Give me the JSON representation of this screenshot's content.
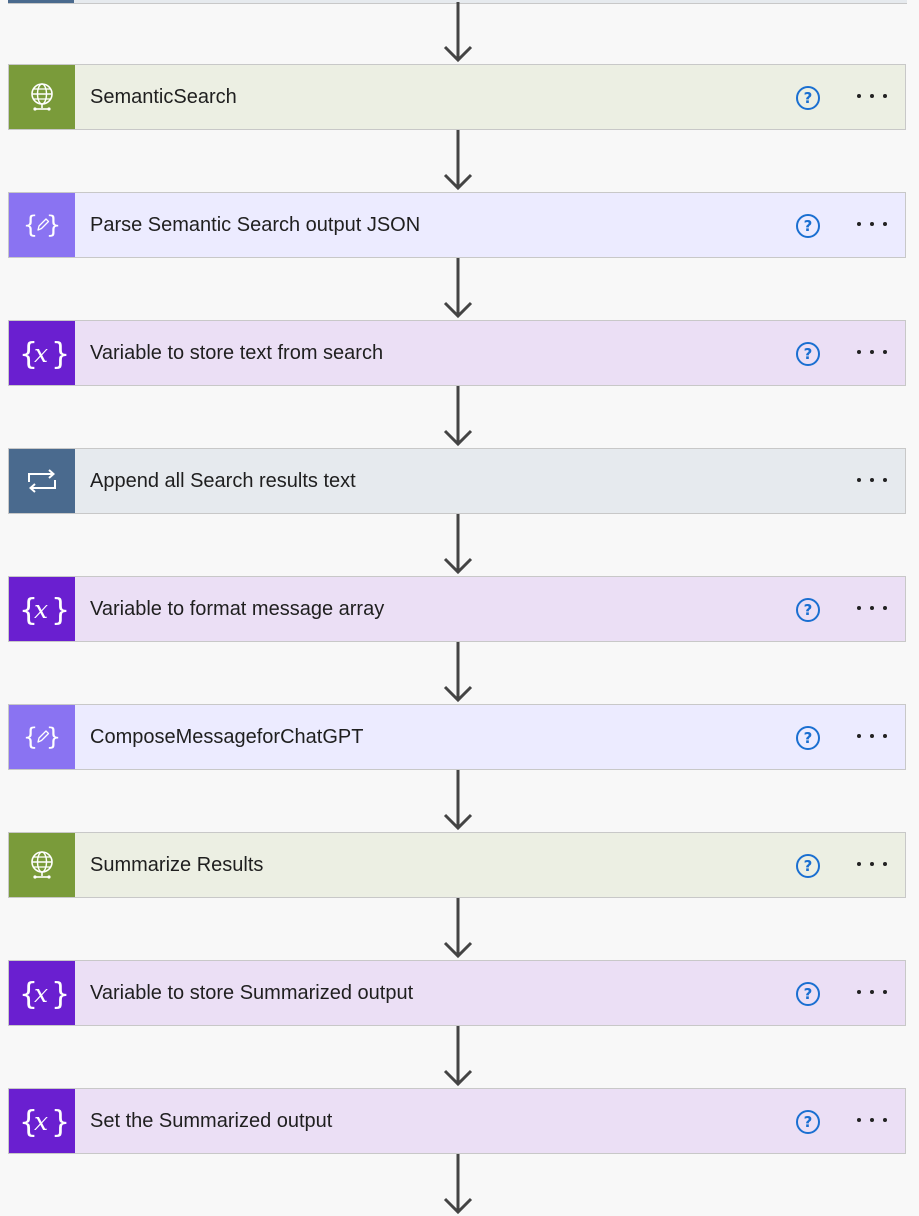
{
  "flow": {
    "steps": [
      {
        "kind": "http",
        "icon": "globe-icon",
        "title": "SemanticSearch",
        "has_help": true
      },
      {
        "kind": "compose",
        "icon": "compose-braces-icon",
        "title": "Parse Semantic Search output JSON",
        "has_help": true
      },
      {
        "kind": "variable",
        "icon": "variable-x-icon",
        "title": "Variable to store text from search",
        "has_help": true
      },
      {
        "kind": "loop",
        "icon": "loop-icon",
        "title": "Append all Search results text",
        "has_help": false
      },
      {
        "kind": "variable",
        "icon": "variable-x-icon",
        "title": "Variable to format message array",
        "has_help": true
      },
      {
        "kind": "compose",
        "icon": "compose-braces-icon",
        "title": "ComposeMessageforChatGPT",
        "has_help": true
      },
      {
        "kind": "http",
        "icon": "globe-icon",
        "title": "Summarize Results",
        "has_help": true
      },
      {
        "kind": "variable",
        "icon": "variable-x-icon",
        "title": "Variable to store Summarized output",
        "has_help": true
      },
      {
        "kind": "variable",
        "icon": "variable-x-icon",
        "title": "Set the Summarized output",
        "has_help": true
      }
    ],
    "help_glyph": "?",
    "colors": {
      "http_accent": "#7a9b3a",
      "http_bg": "#ecefe3",
      "compose_accent": "#8a73f2",
      "compose_bg": "#ecebff",
      "variable_accent": "#6a1fd0",
      "variable_bg": "#ebdff5",
      "loop_accent": "#4a6a8e",
      "loop_bg": "#e6eaee",
      "help_blue": "#1a6fd1",
      "arrow": "#444444"
    }
  }
}
